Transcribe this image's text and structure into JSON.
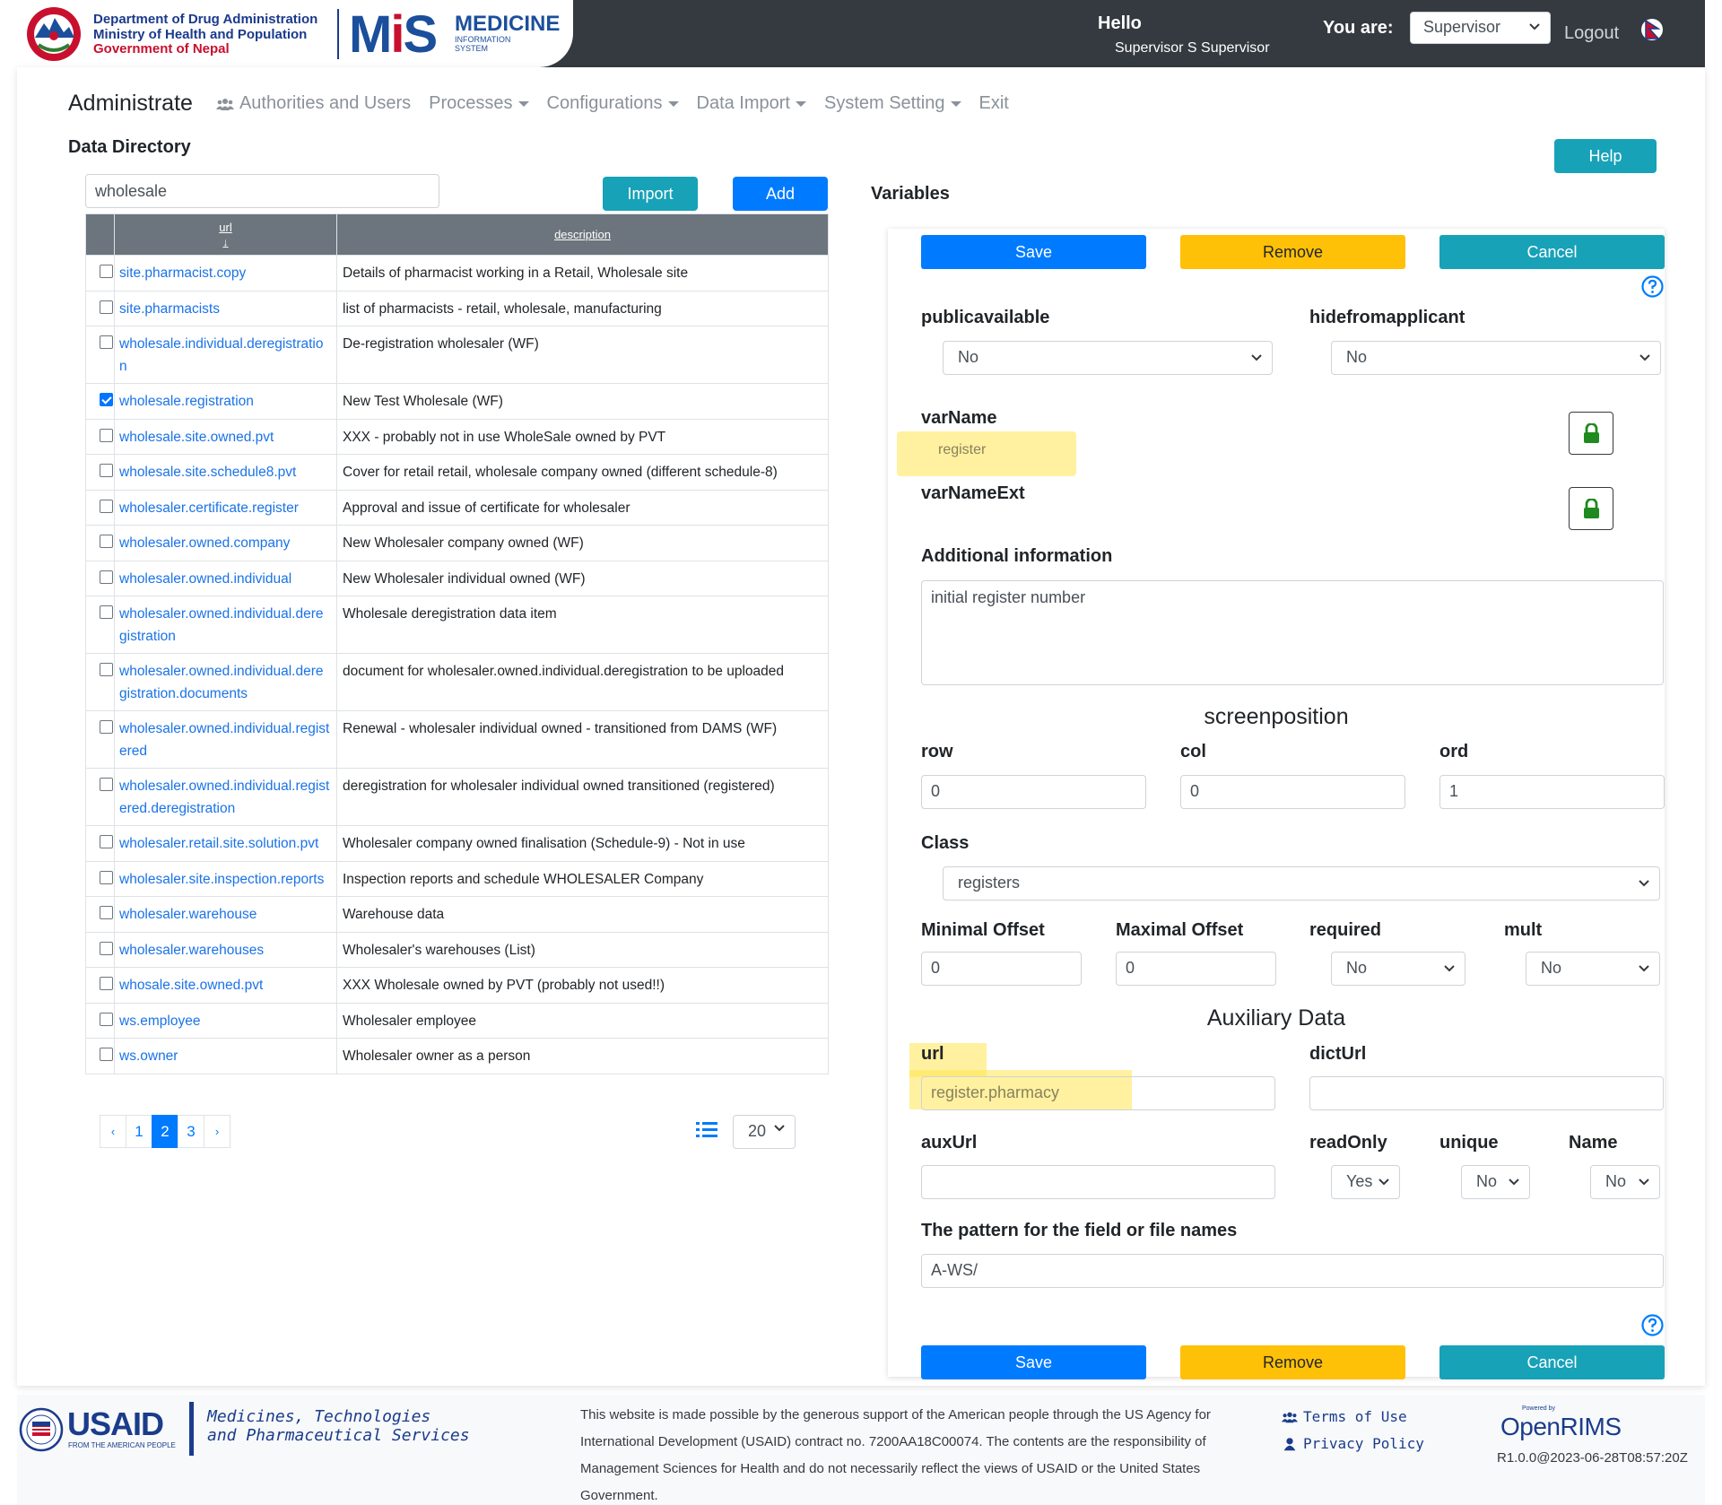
{
  "header": {
    "dept_line1": "Department of Drug Administration",
    "dept_line2": "Ministry of Health and Population",
    "dept_line3": "Government of Nepal",
    "logo_mis_m": "M",
    "logo_mis_i": "i",
    "logo_mis_s": "S",
    "logo_medicine": "MEDICINE",
    "logo_info1": "INFORMATION",
    "logo_info2": "SYSTEM",
    "hello": "Hello",
    "user_name": "Supervisor S Supervisor",
    "you_are": "You are:",
    "role": "Supervisor",
    "logout": "Logout"
  },
  "nav": {
    "brand": "Administrate",
    "items": [
      "Authorities and Users",
      "Processes",
      "Configurations",
      "Data Import",
      "System Setting",
      "Exit"
    ]
  },
  "directory": {
    "title": "Data Directory",
    "help": "Help",
    "search_value": "wholesale",
    "import_label": "Import",
    "add_label": "Add",
    "columns": {
      "url": "url",
      "sort_arrow": "↓",
      "description": "description"
    },
    "rows": [
      {
        "url": "site.pharmacist.copy",
        "description": "Details of pharmacist working in a Retail, Wholesale site",
        "checked": false
      },
      {
        "url": "site.pharmacists",
        "description": "list of pharmacists - retail, wholesale, manufacturing",
        "checked": false
      },
      {
        "url": "wholesale.individual.deregistration",
        "description": "De-registration wholesaler (WF)",
        "checked": false
      },
      {
        "url": "wholesale.registration",
        "description": "New Test Wholesale (WF)",
        "checked": true
      },
      {
        "url": "wholesale.site.owned.pvt",
        "description": "XXX - probably not in use WholeSale owned by PVT",
        "checked": false
      },
      {
        "url": "wholesale.site.schedule8.pvt",
        "description": "Cover for retail retail, wholesale company owned (different schedule-8)",
        "checked": false
      },
      {
        "url": "wholesaler.certificate.register",
        "description": "Approval and issue of certificate for wholesaler",
        "checked": false
      },
      {
        "url": "wholesaler.owned.company",
        "description": "New Wholesaler company owned (WF)",
        "checked": false
      },
      {
        "url": "wholesaler.owned.individual",
        "description": "New Wholesaler individual owned (WF)",
        "checked": false
      },
      {
        "url": "wholesaler.owned.individual.deregistration",
        "description": "Wholesale deregistration data item",
        "checked": false
      },
      {
        "url": "wholesaler.owned.individual.deregistration.documents",
        "description": "document for wholesaler.owned.individual.deregistration to be uploaded",
        "checked": false
      },
      {
        "url": "wholesaler.owned.individual.registered",
        "description": "Renewal - wholesaler individual owned - transitioned from DAMS (WF)",
        "checked": false
      },
      {
        "url": "wholesaler.owned.individual.registered.deregistration",
        "description": "deregistration for wholesaler individual owned transitioned (registered)",
        "checked": false
      },
      {
        "url": "wholesaler.retail.site.solution.pvt",
        "description": "Wholesaler company owned finalisation (Schedule-9) - Not in use",
        "checked": false
      },
      {
        "url": "wholesaler.site.inspection.reports",
        "description": "Inspection reports and schedule WHOLESALER Company",
        "checked": false
      },
      {
        "url": "wholesaler.warehouse",
        "description": "Warehouse data",
        "checked": false
      },
      {
        "url": "wholesaler.warehouses",
        "description": "Wholesaler's warehouses (List)",
        "checked": false
      },
      {
        "url": "whosale.site.owned.pvt",
        "description": "XXX Wholesale owned by PVT (probably not used!!)",
        "checked": false
      },
      {
        "url": "ws.employee",
        "description": "Wholesaler employee",
        "checked": false
      },
      {
        "url": "ws.owner",
        "description": "Wholesaler owner as a person",
        "checked": false
      }
    ],
    "pagination": {
      "prev": "‹",
      "pages": [
        "1",
        "2",
        "3"
      ],
      "active": "2",
      "next": "›"
    },
    "per_page": "20"
  },
  "variables": {
    "title": "Variables",
    "save": "Save",
    "remove": "Remove",
    "cancel": "Cancel",
    "publicavailable_label": "publicavailable",
    "publicavailable_value": "No",
    "hidefromapplicant_label": "hidefromapplicant",
    "hidefromapplicant_value": "No",
    "varname_label": "varName",
    "varname_value": "register",
    "varnameext_label": "varNameExt",
    "additional_label": "Additional information",
    "additional_value": "initial register number",
    "screenposition": "screenposition",
    "row_label": "row",
    "row_value": "0",
    "col_label": "col",
    "col_value": "0",
    "ord_label": "ord",
    "ord_value": "1",
    "class_label": "Class",
    "class_value": "registers",
    "minoffset_label": "Minimal Offset",
    "minoffset_value": "0",
    "maxoffset_label": "Maximal Offset",
    "maxoffset_value": "0",
    "required_label": "required",
    "required_value": "No",
    "mult_label": "mult",
    "mult_value": "No",
    "auxiliary": "Auxiliary Data",
    "url_label": "url",
    "url_value": "register.pharmacy",
    "dicturl_label": "dictUrl",
    "auxurl_label": "auxUrl",
    "readonly_label": "readOnly",
    "readonly_value": "Yes",
    "unique_label": "unique",
    "unique_value": "No",
    "name_label": "Name",
    "name_value": "No",
    "pattern_label": "The pattern for the field or file names",
    "pattern_value": "A-WS/"
  },
  "footer": {
    "usaid": "USAID",
    "usaid_sub": "FROM THE AMERICAN PEOPLE",
    "mtaps_line1": "Medicines, Technologies",
    "mtaps_line2": "and Pharmaceutical Services",
    "support": "This website is made possible by the generous support of the American people through the US Agency for International Development (USAID) contract no. 7200AA18C00074. The contents are the responsibility of Management Sciences for Health and do not necessarily reflect the views of USAID or the United States Government.",
    "terms": "Terms of Use",
    "privacy": "Privacy Policy",
    "powered_by": "Powered by",
    "openrims": "OpenRIMS",
    "version": "R1.0.0@2023-06-28T08:57:20Z"
  },
  "colors": {
    "primary": "#007bff",
    "info": "#17a2b8",
    "warning": "#ffc107",
    "header": "#343a40",
    "brand_blue": "#1b4f9c",
    "brand_red": "#c8102e"
  }
}
